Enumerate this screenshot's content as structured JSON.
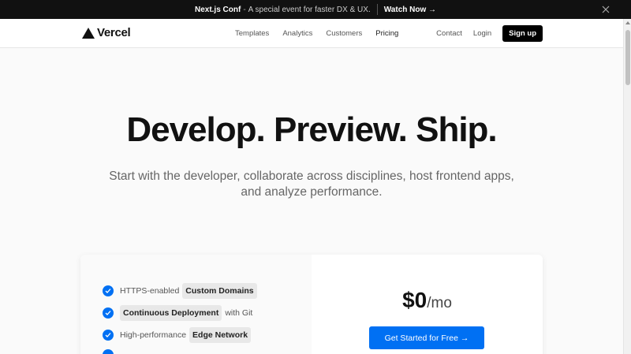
{
  "banner": {
    "event_name": "Next.js Conf",
    "separator": "-",
    "description": "A special event for faster DX & UX.",
    "link_label": "Watch Now →"
  },
  "nav": {
    "logo_text": "Vercel",
    "center_links": [
      "Templates",
      "Analytics",
      "Customers",
      "Pricing"
    ],
    "right_links": [
      "Contact",
      "Login"
    ],
    "signup_label": "Sign up"
  },
  "hero": {
    "title": "Develop. Preview. Ship.",
    "subtitle": "Start with the developer, collaborate across disciplines, host frontend apps, and analyze performance."
  },
  "features": [
    {
      "pre": "HTTPS-enabled",
      "pill": "Custom Domains",
      "post": ""
    },
    {
      "pre": "",
      "pill": "Continuous Deployment",
      "post": "with Git"
    },
    {
      "pre": "High-performance",
      "pill": "Edge Network",
      "post": ""
    }
  ],
  "pricing": {
    "amount": "$0",
    "period": "/mo",
    "cta_label": "Get Started for Free  →"
  },
  "colors": {
    "accent": "#0070f3",
    "banner_bg": "#111111"
  }
}
